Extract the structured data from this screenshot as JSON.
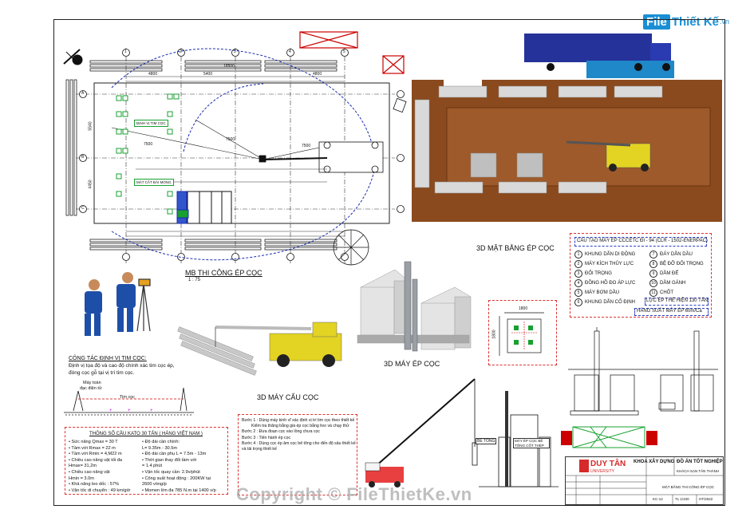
{
  "site_logo": {
    "brand": "File",
    "rest": "Thiết Kế",
    "domain": ".vn"
  },
  "watermark": "Copyright © FileThietKe.vn",
  "plan": {
    "title": "MB THI CÔNG ÉP CỌC",
    "scale": "1 : 75",
    "dims_top": [
      "4800",
      "5400",
      "4800"
    ],
    "dim_total": "18500",
    "dims_left": [
      "5540",
      "4450"
    ],
    "radius_labels": [
      "7500",
      "7500",
      "7500"
    ],
    "tag_1": "ĐỊNH VỊ TIM CỌC",
    "tag_2": "MẶT CẮT ĐÀI MÓNG",
    "axes_top": [
      "1",
      "2",
      "3",
      "4",
      "5"
    ],
    "axes_left": [
      "A",
      "B",
      "C"
    ]
  },
  "view_3d_plan": {
    "title": "3D MẶT BẰNG ÉP CỌC"
  },
  "view_3d_press": {
    "title": "3D MÁY ÉP CỌC"
  },
  "view_3d_crane": {
    "title": "3D MÁY CẨU CỌC"
  },
  "survey": {
    "title": "CÔNG TÁC ĐỊNH VỊ TIM CỌC:",
    "line1": "Định vị tọa độ và cao độ chính xác tim cọc ép,",
    "line2": "đóng cọc gỗ tại vị trí tim cọc.",
    "label_instrument": "Máy toàn",
    "label_instrument2": "đạc điện tử",
    "label_pile": "Tim cọc"
  },
  "crane_specs": {
    "title": "THÔNG SỐ CẦU KATO 30 TẤN ( HÀNG VIỆT NAM )",
    "left": [
      "• Sức nâng Qmax = 30 T",
      "• Tầm với Rmax = 22 m",
      "• Tầm với Rmin = 4,M22 m",
      "• Chiều cao nâng vật tối đa",
      "  Hmax= 31,2m",
      "• Chiều cao nâng vật",
      "  Hmin = 3.0m",
      "• Khả năng leo dốc : 57%",
      "• Vận tốc di chuyển : 49 km/giờ"
    ],
    "right": [
      "• Độ dài cần chính:",
      "  L= 9.35m - 30.5m",
      "• Độ dài cần phụ L = 7.5m - 13m",
      "• Thời gian thay đổi tầm với",
      "  = 1.4 phút",
      "• Vận tốc quay cần: 2.9v/phút",
      "• Công suất hoạt động : 200KW tại",
      "  2600 vòng/p",
      "• Momen lớn đa 785 N.m tại 1400 v/p"
    ]
  },
  "steps": {
    "lines": [
      "Bước 1 : Dùng máy kinh vĩ xác định vị trí tim cọc theo thiết kế",
      "Kiểm tra thăng bằng giá ép cọc bằng livo và chạy thử",
      "Bước 2 : Đưa đoạn cọc vào lồng chưa cọc",
      "Bước 3 : Tiến hành ép cọc",
      "Bước 4 : Dùng cọc ép âm cọc bê tông cho đến độ sâu thiết kế",
      "và tải trọng thiết kế"
    ]
  },
  "press_legend": {
    "title": "CẤU TẠO MÁY ÉP CCCETC ĐI - 94 (CLR - 1502-ENERPAC)",
    "items": [
      {
        "n": "1",
        "label": "KHUNG DẪN DI ĐỘNG"
      },
      {
        "n": "2",
        "label": "MÁY KÍCH THỦY LỰC"
      },
      {
        "n": "3",
        "label": "ĐỐI TRỌNG"
      },
      {
        "n": "4",
        "label": "ĐỒNG HỒ ĐO ÁP LỰC"
      },
      {
        "n": "5",
        "label": "MÁY BƠM DẦU"
      },
      {
        "n": "6",
        "label": "KHUNG DẪN CỐ ĐỊNH"
      },
      {
        "n": "7",
        "label": "ĐÁY DẪN DẦU"
      },
      {
        "n": "8",
        "label": "BỆ ĐỠ ĐỐI TRỌNG"
      },
      {
        "n": "9",
        "label": "DẦM ĐẾ"
      },
      {
        "n": "10",
        "label": "DẦM GÁNH"
      },
      {
        "n": "11",
        "label": "CHỐT"
      }
    ],
    "note1": "LỰC ÉP THẾ HIỆN 130 TẤN",
    "note2": "HÀNG SUẤT MÁY ÉP 60m/Ca"
  },
  "footing": {
    "dims": [
      "1800",
      "1800"
    ]
  },
  "annotations": {
    "pile_label": "BÊ TÔNG",
    "press_label": "MÁY ÉP CỌC BÊ TÔNG CỐT THÉP"
  },
  "title_block": {
    "university": "DUY TÂN",
    "university_sub": "UNIVERSITY",
    "faculty": "KHOA XÂY DỰNG",
    "project": "ĐỒ ÁN TỐT NGHIỆP",
    "building": "KHÁCH SẠN TÂN THÀNH",
    "sheet_name": "MẶT BẰNG THI CÔNG ÉP CỌC",
    "code": "KC-12",
    "scale": "TL 1/100",
    "date": "HT/2022"
  },
  "colors": {
    "border": "#222222",
    "accent_red": "#cc0000",
    "accent_blue": "#1a2db0",
    "site_soil": "#8a4a1e",
    "crane_yellow": "#e3d323",
    "logo_blue": "#1a8fd6"
  }
}
